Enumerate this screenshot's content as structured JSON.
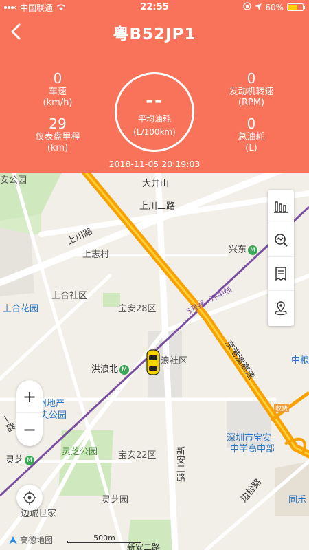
{
  "status_bar": {
    "carrier": "中国联通",
    "time": "22:55",
    "battery": "60%"
  },
  "header": {
    "title": "粤B52JP1",
    "speed": {
      "value": "0",
      "label": "车速",
      "unit": "(km/h)"
    },
    "rpm": {
      "value": "0",
      "label": "发动机转速",
      "unit": "(RPM)"
    },
    "odometer": {
      "value": "29",
      "label": "仪表盘里程",
      "unit": "(km)"
    },
    "total_fuel": {
      "value": "0",
      "label": "总油耗",
      "unit": "(L)"
    },
    "avg_fuel": {
      "value": "--",
      "label": "平均油耗",
      "unit": "(L/100km)"
    },
    "timestamp": "2018-11-05 20:19:03"
  },
  "map": {
    "labels": {
      "daxingshan": "大井山",
      "shangchuan2": "上川二路",
      "shangchuan": "上川路",
      "shangzhicun": "上志村",
      "xingdong": "兴东",
      "shanghe": "上合社区",
      "shanghehuayuan": "上合花园",
      "baoan28": "宝安28区",
      "metro5": "5号线 · 环中线",
      "jinggang": "京港澳高速",
      "honglangbei": "洪浪北",
      "langshequ": "浪社区",
      "zhongliang": "中粮",
      "shoufei": "收费",
      "zhongyang": "中央公园",
      "dichan": "州地产",
      "lingzhigongyuan": "灵芝公园",
      "baoan22": "宝安22区",
      "xinan2": "新安二路",
      "shenzhenbaoan": "深圳市宝安",
      "gaozhongbu": "中学高中部",
      "lingzhi": "灵芝",
      "lingzhiyuan": "灵芝园",
      "biancheng": "边城世家",
      "bianjian": "边检路",
      "tongle": "同乐",
      "anbong": "安公园",
      "partial_road": "一路",
      "xinan_bottom": "新安二路"
    },
    "brand": "高德地图",
    "scale": "500m",
    "zoom_in": "+",
    "zoom_out": "−"
  },
  "colors": {
    "header": "#f9735b",
    "highway": "#f7a200",
    "metro": "#7b4fa0",
    "metro_station": "#3aa757"
  }
}
